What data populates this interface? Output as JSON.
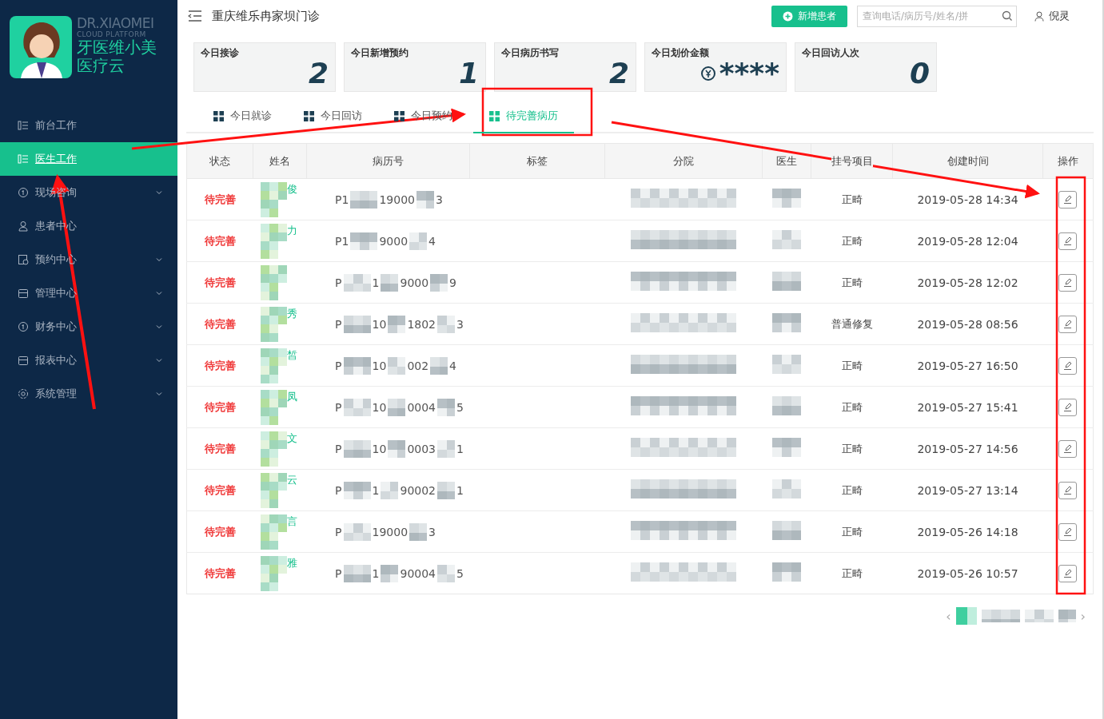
{
  "logo": {
    "latin_name": "DR.XIAOMEI",
    "latin_sub": "CLOUD PLATFORM",
    "name_line_1": "牙医维小美",
    "name_line_2": "医疗云"
  },
  "sidebar": {
    "items": [
      {
        "label": "前台工作",
        "selected": false,
        "expandable": false
      },
      {
        "label": "医生工作",
        "selected": true,
        "expandable": false
      },
      {
        "label": "现场咨询",
        "selected": false,
        "expandable": true
      },
      {
        "label": "患者中心",
        "selected": false,
        "expandable": false
      },
      {
        "label": "预约中心",
        "selected": false,
        "expandable": true
      },
      {
        "label": "管理中心",
        "selected": false,
        "expandable": true
      },
      {
        "label": "财务中心",
        "selected": false,
        "expandable": true
      },
      {
        "label": "报表中心",
        "selected": false,
        "expandable": true
      },
      {
        "label": "系统管理",
        "selected": false,
        "expandable": true
      }
    ]
  },
  "header": {
    "title": "重庆维乐冉家坝门诊",
    "add_button": "新增患者",
    "search": {
      "placeholder": "查询电话/病历号/姓名/拼"
    },
    "user": "倪灵"
  },
  "stats": [
    {
      "label": "今日接诊",
      "value": "2",
      "kind": "count"
    },
    {
      "label": "今日新增预约",
      "value": "1",
      "kind": "count"
    },
    {
      "label": "今日病历书写",
      "value": "2",
      "kind": "count"
    },
    {
      "label": "今日划价金额",
      "value": "****",
      "kind": "money"
    },
    {
      "label": "今日回访人次",
      "value": "0",
      "kind": "count"
    }
  ],
  "tabs": [
    {
      "label": "今日就诊",
      "selected": false
    },
    {
      "label": "今日回访",
      "selected": false
    },
    {
      "label": "今日预约",
      "selected": false
    },
    {
      "label": "待完善病历",
      "selected": true
    }
  ],
  "table": {
    "columns": [
      "状态",
      "姓名",
      "病历号",
      "标签",
      "分院",
      "医生",
      "挂号项目",
      "创建时间",
      "操作"
    ],
    "rows": [
      {
        "status": "待完善",
        "name": "俊",
        "record_parts": [
          "P1",
          "19000",
          "3"
        ],
        "project": "正畸",
        "created": "2019-05-28 14:34"
      },
      {
        "status": "待完善",
        "name": "力",
        "record_parts": [
          "P1",
          "9000",
          "4"
        ],
        "project": "正畸",
        "created": "2019-05-28 12:04"
      },
      {
        "status": "待完善",
        "record_parts": [
          "P",
          "1",
          "9000",
          "9"
        ],
        "project": "正畸",
        "created": "2019-05-28 12:02"
      },
      {
        "status": "待完善",
        "name": "秀",
        "record_parts": [
          "P",
          "10",
          "1802",
          "3"
        ],
        "project": "普通修复",
        "created": "2019-05-28 08:56"
      },
      {
        "status": "待完善",
        "name": "皙",
        "record_parts": [
          "P",
          "10",
          "002",
          "4"
        ],
        "project": "正畸",
        "created": "2019-05-27 16:50"
      },
      {
        "status": "待完善",
        "name": "凤",
        "record_parts": [
          "P",
          "10",
          "0004",
          "5"
        ],
        "project": "正畸",
        "created": "2019-05-27 15:41"
      },
      {
        "status": "待完善",
        "name": "文",
        "record_parts": [
          "P",
          "10",
          "0003",
          "1"
        ],
        "project": "正畸",
        "created": "2019-05-27 14:56"
      },
      {
        "status": "待完善",
        "name": "云",
        "record_parts": [
          "P",
          "1",
          "90002",
          "1"
        ],
        "project": "正畸",
        "created": "2019-05-27 13:14"
      },
      {
        "status": "待完善",
        "name": "言",
        "record_parts": [
          "P",
          "19000",
          "3"
        ],
        "project": "正畸",
        "created": "2019-05-26 14:18"
      },
      {
        "status": "待完善",
        "name": "雅",
        "record_parts": [
          "P",
          "1",
          "90004",
          "5"
        ],
        "project": "正畸",
        "created": "2019-05-26 10:57"
      }
    ]
  },
  "pagination": {
    "prev": "‹",
    "next": "›"
  }
}
